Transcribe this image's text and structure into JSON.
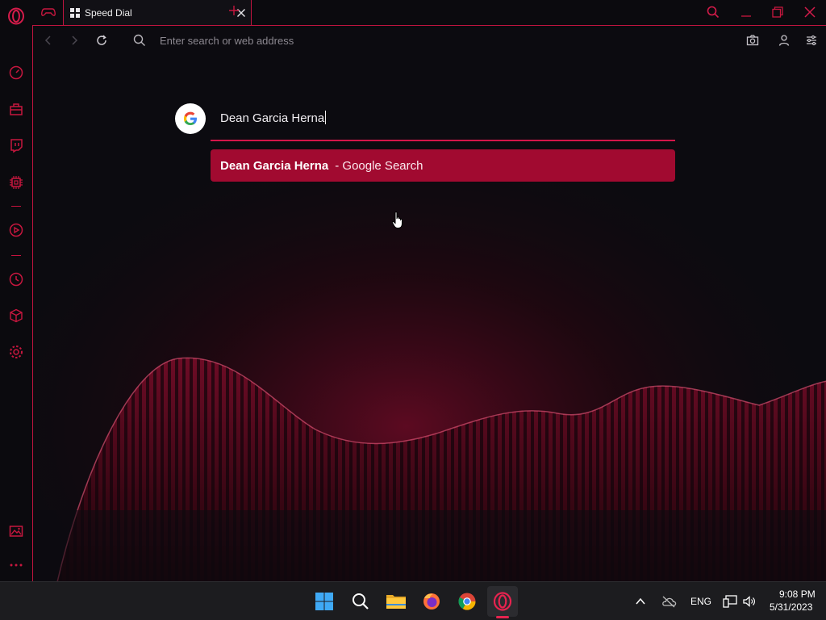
{
  "tab": {
    "title": "Speed Dial"
  },
  "address_bar": {
    "placeholder": "Enter search or web address"
  },
  "search": {
    "query": "Dean Garcia Herna",
    "suggestion_bold": "Dean Garcia Herna",
    "suggestion_suffix": "- Google Search"
  },
  "sidebar": {
    "items": [
      "opera-logo-icon",
      "speedometer-icon",
      "shopping-bag-icon",
      "twitch-icon",
      "chip-icon",
      "player-icon",
      "history-icon",
      "cube-icon",
      "settings-icon",
      "wallpaper-icon",
      "more-icon"
    ]
  },
  "tray": {
    "language": "ENG",
    "time": "9:08 PM",
    "date": "5/31/2023"
  },
  "colors": {
    "accent": "#c0143f",
    "suggestion_bg": "#a10a30",
    "background": "#0b0a0e"
  }
}
